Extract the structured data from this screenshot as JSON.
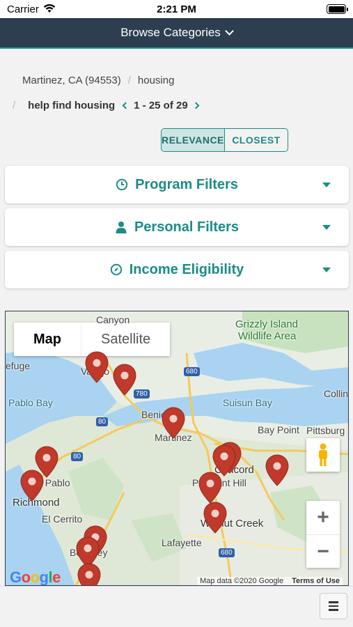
{
  "status_bar": {
    "carrier": "Carrier",
    "time": "2:21 PM"
  },
  "header": {
    "title": "Browse Categories",
    "icon": "chevron-down-icon"
  },
  "breadcrumb": {
    "location": "Martinez, CA (94553)",
    "category": "housing",
    "subcategory": "help find housing",
    "range": "1 - 25 of 29"
  },
  "sort": {
    "relevance": "RELEVANCE",
    "closest": "CLOSEST",
    "selected": "RELEVANCE"
  },
  "filters": {
    "program": {
      "label": "Program Filters",
      "icon": "clock-icon"
    },
    "personal": {
      "label": "Personal Filters",
      "icon": "person-icon"
    },
    "income": {
      "label": "Income Eligibility",
      "icon": "compass-icon"
    }
  },
  "map": {
    "type_map": "Map",
    "type_satellite": "Satellite",
    "zoom_in": "+",
    "zoom_out": "−",
    "logo": "Google",
    "attribution": "Map data ©2020 Google",
    "terms": "Terms of Use",
    "labels": {
      "canyon": "Canyon",
      "grizzly1": "Grizzly Island",
      "grizzly2": "Wildlife Area",
      "vallejo": "Vallejo",
      "benicia": "Benicia",
      "martinez": "Martinez",
      "suisun": "Suisun Bay",
      "pablo": "Pablo Bay",
      "collin": "Collin",
      "baypoint": "Bay Point",
      "pittsburg": "Pittsburg",
      "concord": "Concord",
      "sanpablo": "San Pablo",
      "richmond": "Richmond",
      "pleasanthill": "Pleasant Hill",
      "elcerrito": "El Cerrito",
      "walnutcreek": "Walnut Creek",
      "lafayette": "Lafayette",
      "berkeley": "Berkeley",
      "refuge": "efuge",
      "hw680a": "680",
      "hw780": "780",
      "hw80a": "80",
      "hw80b": "80",
      "hw680b": "680"
    },
    "markers_count": 16
  },
  "bottom": {
    "menu_icon": "hamburger-icon"
  },
  "colors": {
    "accent": "#1b8c88",
    "header": "#2c3e50",
    "marker": "#c0392b"
  }
}
